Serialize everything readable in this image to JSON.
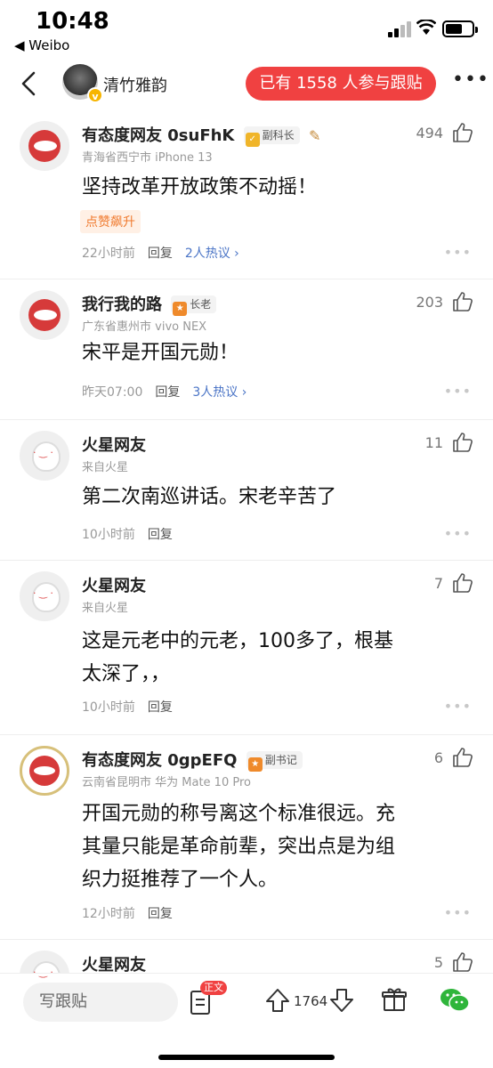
{
  "status_bar": {
    "time": "10:48",
    "back_app": "◀ Weibo"
  },
  "header": {
    "user_name": "清竹雅韵",
    "verified_badge": "v",
    "follow_button": "已有 1558 人参与跟贴",
    "more": "•••"
  },
  "comments": [
    {
      "name": "有态度网友 0suFhK",
      "badge": "副科长",
      "badge_icon": "shield",
      "location": "青海省西宁市  iPhone 13",
      "likes": "494",
      "text": "坚持改革开放政策不动摇！",
      "tag": "点赞飙升",
      "time": "22小时前",
      "reply": "回复",
      "hot": "2人热议 ›",
      "avatar": "red"
    },
    {
      "name": "我行我的路",
      "badge": "长老",
      "badge_icon": "star",
      "location": "广东省惠州市  vivo NEX",
      "likes": "203",
      "text": "宋平是开国元勋！",
      "time": "昨天07:00",
      "reply": "回复",
      "hot": "3人热议 ›",
      "avatar": "red"
    },
    {
      "name": "火星网友",
      "location": "来自火星",
      "likes": "11",
      "text": "第二次南巡讲话。宋老辛苦了",
      "time": "10小时前",
      "reply": "回复",
      "avatar": "ghost"
    },
    {
      "name": "火星网友",
      "location": "来自火星",
      "likes": "7",
      "text_lines": [
        "这是元老中的元老，100多了，根基",
        "太深了，，"
      ],
      "time": "10小时前",
      "reply": "回复",
      "avatar": "ghost"
    },
    {
      "name": "有态度网友 0gpEFQ",
      "badge": "副书记",
      "badge_icon": "star",
      "location": "云南省昆明市  华为 Mate 10 Pro",
      "likes": "6",
      "text_lines": [
        "开国元勋的称号离这个标准很远。充",
        "其量只能是革命前辈，突出点是为组",
        "织力挺推荐了一个人。"
      ],
      "time": "12小时前",
      "reply": "回复",
      "avatar": "wreath"
    },
    {
      "name": "火星网友",
      "likes": "5",
      "avatar": "ghost"
    }
  ],
  "bottom_bar": {
    "input_placeholder": "写跟贴",
    "doc_badge": "正文",
    "vote_count": "1764"
  }
}
